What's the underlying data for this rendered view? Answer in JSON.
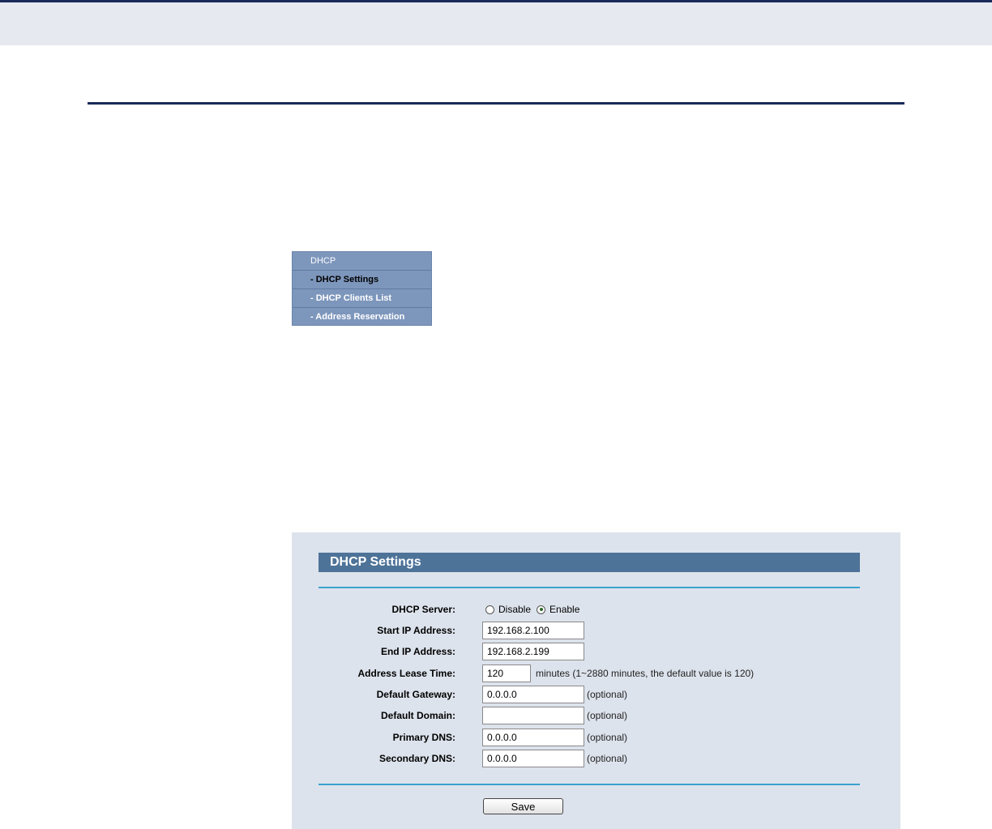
{
  "menu": {
    "items": [
      {
        "label": "DHCP"
      },
      {
        "label": "- DHCP Settings"
      },
      {
        "label": "- DHCP Clients List"
      },
      {
        "label": "- Address Reservation"
      }
    ]
  },
  "panel": {
    "title": "DHCP Settings",
    "dhcp_server": {
      "label": "DHCP Server:",
      "options": [
        "Disable",
        "Enable"
      ],
      "selected": "Enable"
    },
    "start_ip": {
      "label": "Start IP Address:",
      "value": "192.168.2.100"
    },
    "end_ip": {
      "label": "End IP Address:",
      "value": "192.168.2.199"
    },
    "lease_time": {
      "label": "Address Lease Time:",
      "value": "120",
      "note": "minutes (1~2880 minutes, the default value is 120)"
    },
    "gateway": {
      "label": "Default Gateway:",
      "value": "0.0.0.0",
      "note": "(optional)"
    },
    "domain": {
      "label": "Default Domain:",
      "value": "",
      "note": "(optional)"
    },
    "primary_dns": {
      "label": "Primary DNS:",
      "value": "0.0.0.0",
      "note": "(optional)"
    },
    "secondary_dns": {
      "label": "Secondary DNS:",
      "value": "0.0.0.0",
      "note": "(optional)"
    },
    "save_label": "Save"
  },
  "colors": {
    "header_bar": "#4e7398",
    "menu_bg": "#7d96bc",
    "separator": "#3aa1cf",
    "panel_bg": "#dde3ec",
    "rule": "#1a2a5a"
  }
}
